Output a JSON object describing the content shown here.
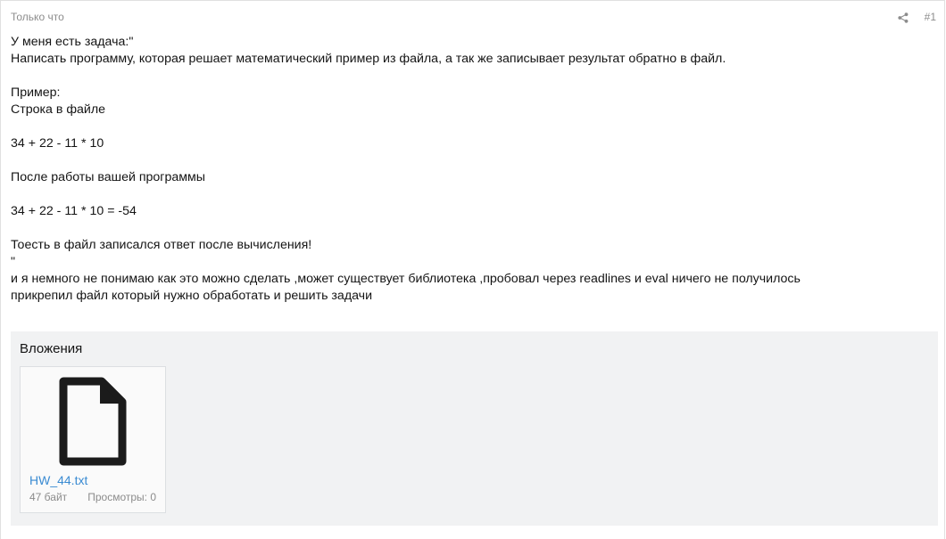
{
  "post": {
    "time": "Только что",
    "number": "#1",
    "body_lines": [
      "У меня есть задача:\"",
      "Написать программу, которая решает математический пример из файла, а так же записывает результат обратно в файл.",
      "",
      "Пример:",
      "Строка в файле",
      "",
      "34 + 22 - 11 * 10",
      "",
      "После работы вашей программы",
      "",
      "34 + 22 - 11 * 10 = -54",
      "",
      "Тоесть в файл записался ответ после вычисления!",
      "\"",
      "и я немного не понимаю как это можно сделать ,может существует библиотека ,пробовал через readlines и eval ничего не получилось",
      "прикрепил файл который нужно обработать и решить задачи"
    ]
  },
  "attachments": {
    "title": "Вложения",
    "items": [
      {
        "name": "HW_44.txt",
        "size": "47 байт",
        "views": "Просмотры: 0",
        "icon": "file-icon"
      }
    ]
  },
  "icons": {
    "share": "share-icon"
  },
  "colors": {
    "link": "#3a8bd2",
    "muted": "#8c8c8c",
    "attachments_bg": "#f1f2f3"
  }
}
